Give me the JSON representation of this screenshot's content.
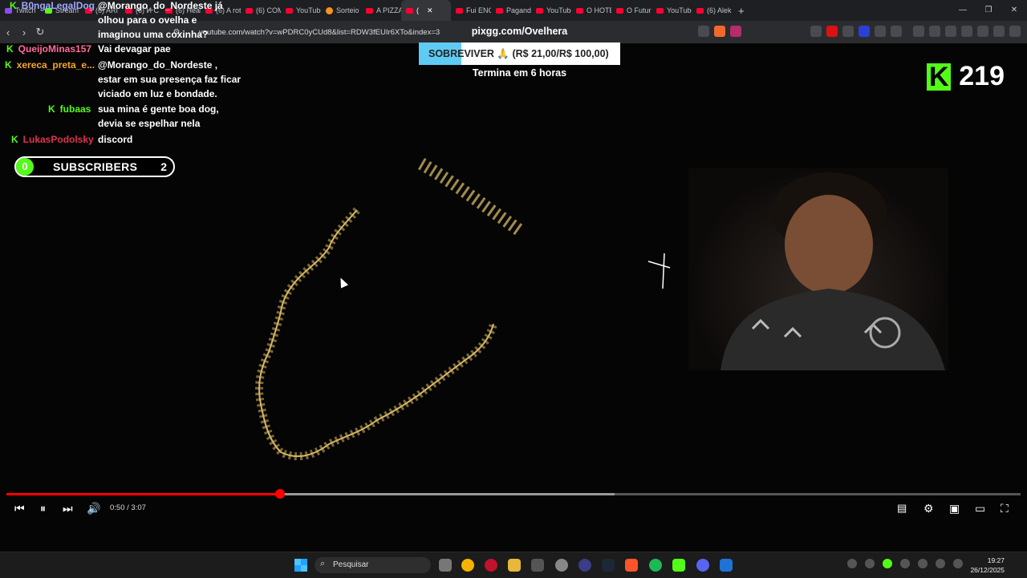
{
  "browser": {
    "tabs": [
      {
        "label": "Twitch",
        "kind": "twitch"
      },
      {
        "label": "Stream",
        "kind": "kick"
      },
      {
        "label": "(6) ARI",
        "kind": "yt"
      },
      {
        "label": "(6) И С",
        "kind": "yt"
      },
      {
        "label": "(6) Hear",
        "kind": "yt"
      },
      {
        "label": "(6) A rot",
        "kind": "yt"
      },
      {
        "label": "(6) COM",
        "kind": "yt"
      },
      {
        "label": "YouTube",
        "kind": "yt"
      },
      {
        "label": "Sorteio",
        "kind": "orange"
      },
      {
        "label": "A PIZZA",
        "kind": "yt"
      },
      {
        "label": "(",
        "kind": "yt",
        "active": true
      },
      {
        "label": "Fui ENG",
        "kind": "yt"
      },
      {
        "label": "Pagand",
        "kind": "yt"
      },
      {
        "label": "YouTube",
        "kind": "yt"
      },
      {
        "label": "O HOTE",
        "kind": "yt"
      },
      {
        "label": "O Futur",
        "kind": "yt"
      },
      {
        "label": "YouTube",
        "kind": "yt"
      },
      {
        "label": "(6) Alek",
        "kind": "yt"
      }
    ],
    "url": "youtube.com/watch?v=wPDRC0yCUd8&list=RDW3fEUIr6XTo&index=3"
  },
  "chat": [
    {
      "user": "B0ngaLegalDog",
      "user_color": "#9fa8ff",
      "message": "@Morango_do_Nordeste já olhou para o ovelha e imaginou uma coxinha?"
    },
    {
      "user": "QueijoMinas157",
      "user_color": "#ff6b9a",
      "message": "Vai devagar pae"
    },
    {
      "user": "xereca_preta_e...",
      "user_color": "#f5a623",
      "message": "@Morango_do_Nordeste , estar em sua presença faz ficar viciado em luz e bondade."
    },
    {
      "user": "fubaas",
      "user_color": "#53fc18",
      "message": "sua mina é gente boa dog, devia se espelhar nela"
    },
    {
      "user": "LukasPodolsky",
      "user_color": "#e0334f",
      "message": "discord"
    }
  ],
  "subscribers_widget": {
    "left_count": "0",
    "title": "SUBSCRIBERS",
    "right_count": "2"
  },
  "pix": {
    "domain": "pixgg.com/Ovelhera",
    "goal_text": "SOBREVIVER 🙏 (R$ 21,00/R$ 100,00)",
    "progress_fraction": 0.21,
    "ends_text": "Termina em 6 horas"
  },
  "viewers": {
    "logo": "K",
    "count": "219"
  },
  "player": {
    "time": "0:50 / 3:07",
    "played_fraction": 0.27,
    "buffered_fraction": 0.6
  },
  "taskbar": {
    "search_placeholder": "Pesquisar",
    "time": "19:27",
    "date": "26/12/2025"
  },
  "colors": {
    "kick_green": "#53fc18",
    "youtube_red": "#ff0000",
    "pix_blue": "#5ecbf5"
  }
}
